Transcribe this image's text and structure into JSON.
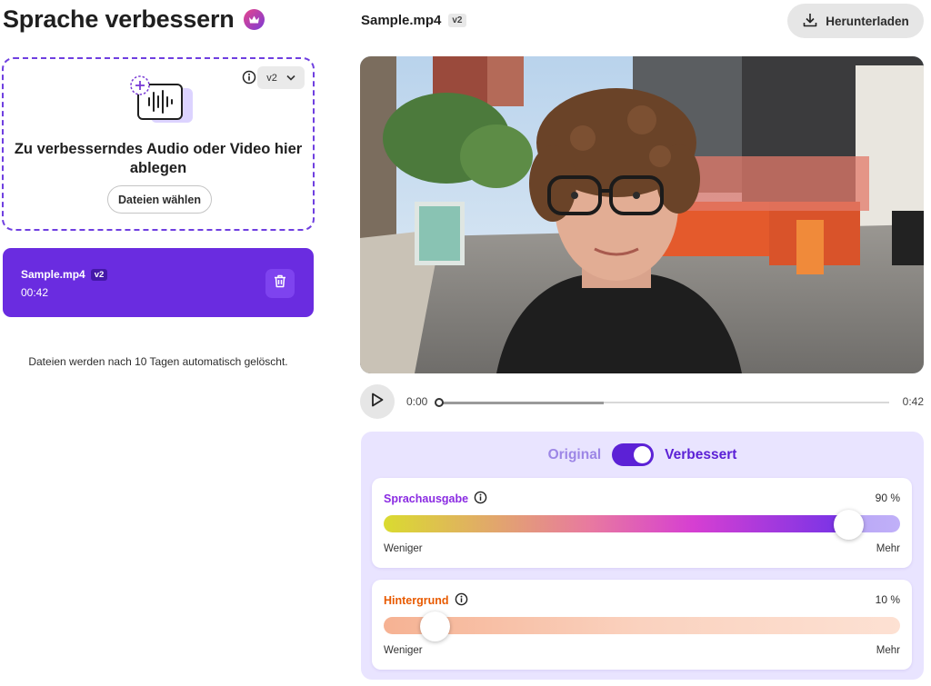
{
  "app": {
    "title": "Sprache verbessern"
  },
  "dropzone": {
    "version": "v2",
    "prompt": "Zu verbesserndes Audio oder Video hier ablegen",
    "choose_files_label": "Dateien wählen"
  },
  "file": {
    "name": "Sample.mp4",
    "version": "v2",
    "duration": "00:42"
  },
  "retention_note": "Dateien werden nach 10 Tagen automatisch gelöscht.",
  "preview": {
    "file_name": "Sample.mp4",
    "version": "v2",
    "download_label": "Herunterladen"
  },
  "player": {
    "current_time": "0:00",
    "total_time": "0:42",
    "buffered_fraction": 0.37,
    "played_fraction": 0.0
  },
  "compare": {
    "original_label": "Original",
    "enhanced_label": "Verbessert",
    "enhanced_active": true
  },
  "speech": {
    "title": "Sprachausgabe",
    "value_label": "90 %",
    "value": 0.9,
    "min_label": "Weniger",
    "max_label": "Mehr",
    "title_color": "#8a2be2"
  },
  "background": {
    "title": "Hintergrund",
    "value_label": "10 %",
    "value": 0.1,
    "min_label": "Weniger",
    "max_label": "Mehr",
    "title_color": "#e85a00"
  },
  "colors": {
    "accent": "#6a2ce0",
    "panel": "#e9e4ff"
  },
  "icons": [
    "crown-icon",
    "info-icon",
    "chevron-down-icon",
    "audio-upload-icon",
    "trash-icon",
    "download-icon",
    "play-icon"
  ]
}
